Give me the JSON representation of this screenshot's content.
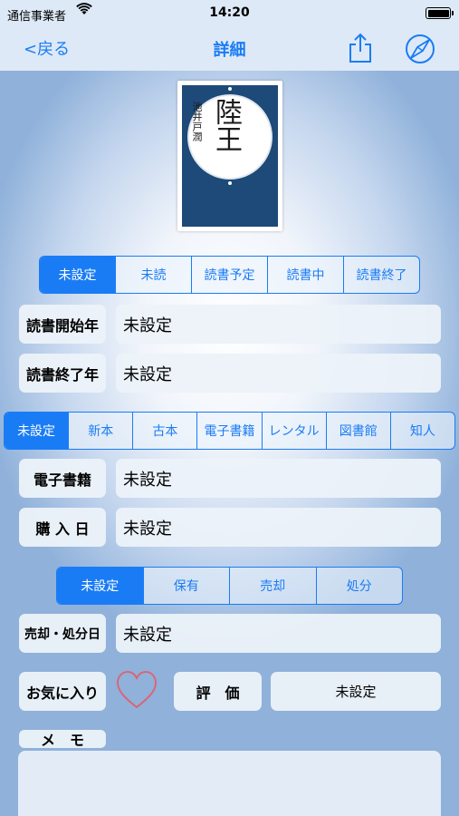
{
  "status": {
    "carrier": "通信事業者",
    "time": "14:20"
  },
  "nav": {
    "back": "<戻る",
    "title": "詳細"
  },
  "cover": {
    "title": "陸王",
    "author": "池井戸潤"
  },
  "reading_status": {
    "options": [
      "未設定",
      "未読",
      "読書予定",
      "読書中",
      "読書終了"
    ],
    "selected": "未設定"
  },
  "reading_start": {
    "label": "読書開始年",
    "value": "未設定"
  },
  "reading_end": {
    "label": "読書終了年",
    "value": "未設定"
  },
  "book_type": {
    "options": [
      "未設定",
      "新本",
      "古本",
      "電子書籍",
      "レンタル",
      "図書館",
      "知人"
    ],
    "selected": "未設定"
  },
  "ebook": {
    "label": "電子書籍",
    "value": "未設定"
  },
  "purchase_date": {
    "label": "購 入 日",
    "value": "未設定"
  },
  "ownership": {
    "options": [
      "未設定",
      "保有",
      "売却",
      "処分"
    ],
    "selected": "未設定"
  },
  "sell_date": {
    "label": "売却・処分日",
    "value": "未設定"
  },
  "favorite": {
    "label": "お気に入り"
  },
  "rating": {
    "label": "評　価",
    "value": "未設定"
  },
  "memo": {
    "label": "メ　モ",
    "value": ""
  },
  "colors": {
    "accent": "#1a7cf5",
    "heart": "#e06070"
  }
}
